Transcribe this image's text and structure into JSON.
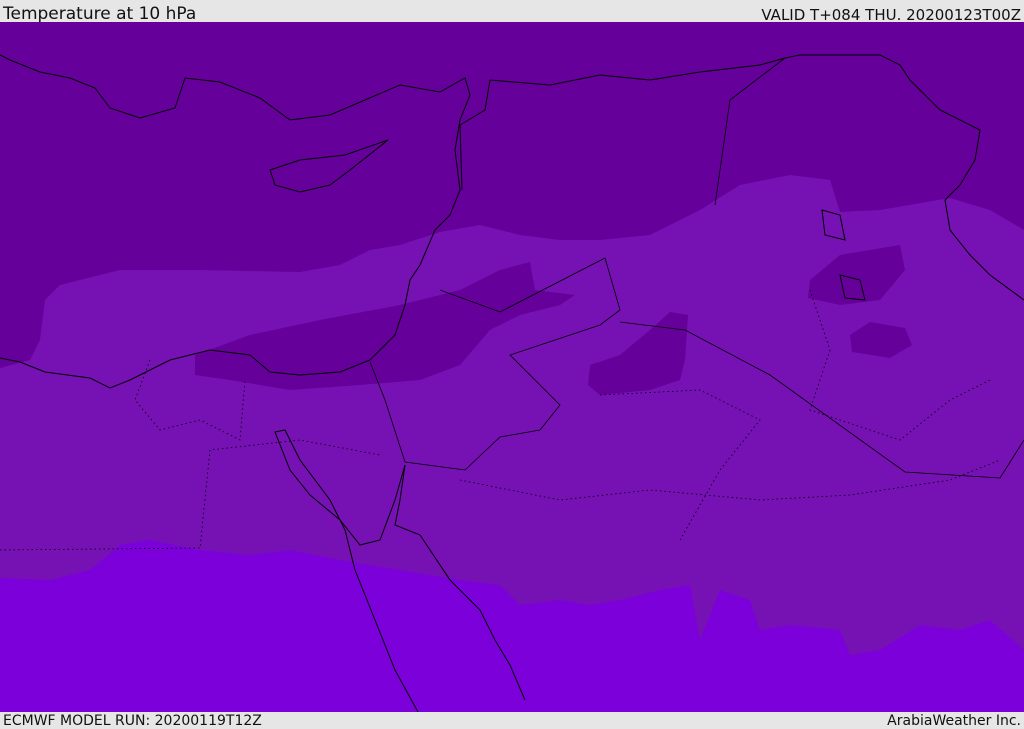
{
  "header": {
    "title": "Temperature at 10 hPa",
    "valid": "VALID T+084 THU. 20200123T00Z"
  },
  "footer": {
    "model_run": "ECMWF MODEL RUN: 20200119T12Z",
    "brand": "ArabiaWeather Inc."
  },
  "colors": {
    "band_cold": "#65009a",
    "band_mid": "#7612b3",
    "band_warm": "#7c00da",
    "coastline": "#000000"
  }
}
